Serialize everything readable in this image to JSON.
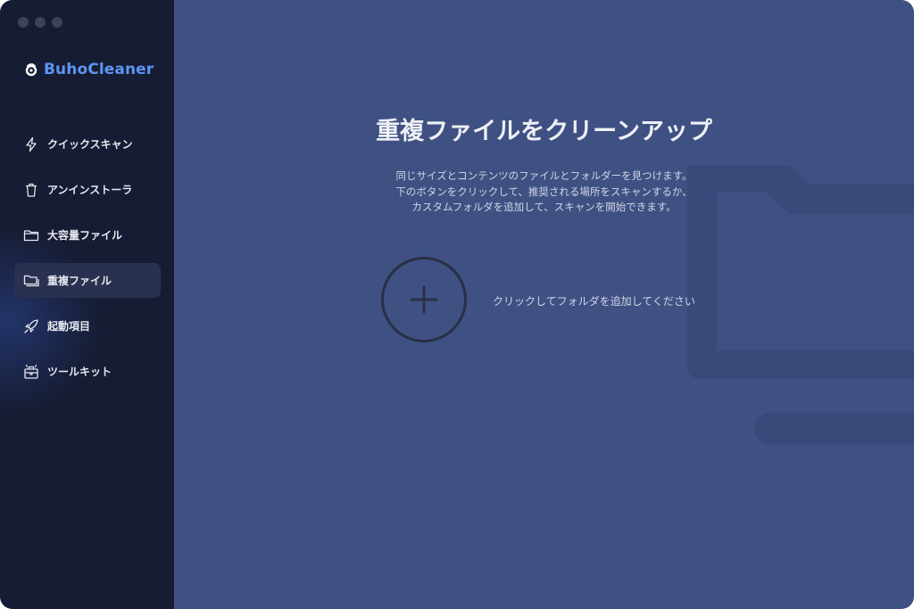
{
  "app": {
    "name": "BuhoCleaner"
  },
  "sidebar": {
    "items": [
      {
        "label": "クイックスキャン",
        "icon": "lightning-icon",
        "active": false
      },
      {
        "label": "アンインストーラ",
        "icon": "trash-icon",
        "active": false
      },
      {
        "label": "大容量ファイル",
        "icon": "folder-icon",
        "active": false
      },
      {
        "label": "重複ファイル",
        "icon": "duplicate-folder-icon",
        "active": true
      },
      {
        "label": "起動項目",
        "icon": "rocket-icon",
        "active": false
      },
      {
        "label": "ツールキット",
        "icon": "toolkit-icon",
        "active": false
      }
    ]
  },
  "main": {
    "title": "重複ファイルをクリーンアップ",
    "description": [
      "同じサイズとコンテンツのファイルとフォルダーを見つけます。",
      "下のボタンをクリックして、推奨される場所をスキャンするか、",
      "カスタムフォルダを追加して、スキャンを開始できます。"
    ],
    "add_folder_label": "クリックしてフォルダを追加してください"
  },
  "colors": {
    "sidebar_bg": "#161c33",
    "main_bg": "#3f5183",
    "brand": "#5d96f3",
    "active_item_bg": "#2a3150"
  }
}
